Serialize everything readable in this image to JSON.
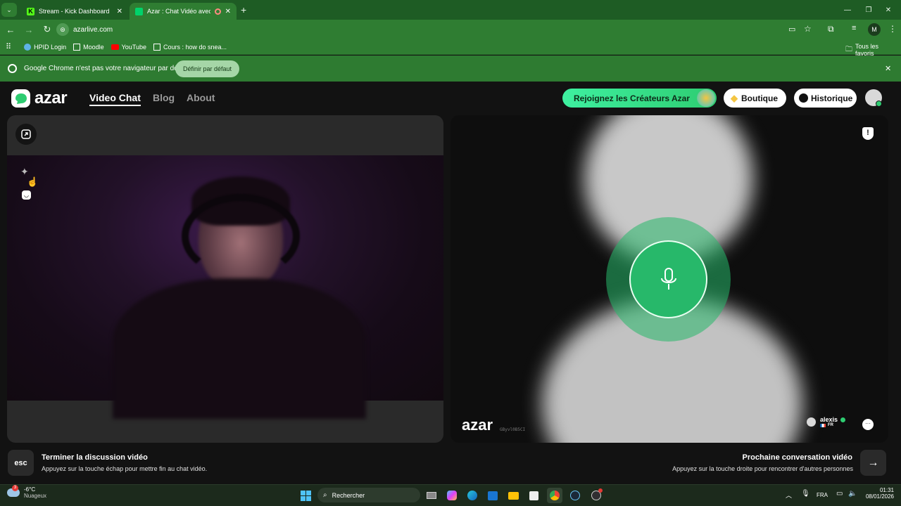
{
  "browser": {
    "tabs": [
      {
        "label": "Stream - Kick Dashboard",
        "color": "#53fc18"
      },
      {
        "label": "Azar : Chat Vidéo avec de n",
        "color": "#00d26a"
      }
    ],
    "url": "azarlive.com",
    "bookmarks": [
      "HPID Login",
      "Moodle",
      "YouTube",
      "Cours : how do snea..."
    ],
    "all_bookmarks": "Tous les favoris",
    "profile_initial": "M",
    "infobar": {
      "message": "Google Chrome n'est pas votre navigateur par défaut",
      "button": "Définir par défaut"
    }
  },
  "site": {
    "logo_text": "azar",
    "nav": [
      "Video Chat",
      "Blog",
      "About"
    ],
    "creators_button": "Rejoignez les Créateurs Azar",
    "shop_button": "Boutique",
    "history_button": "Historique"
  },
  "remote": {
    "watermark": "azar",
    "user_code": "GByvl0B5CI",
    "user_name": "alexis",
    "country": "FR"
  },
  "footer": {
    "esc_key": "esc",
    "end_title": "Terminer la discussion vidéo",
    "end_desc": "Appuyez sur la touche échap pour mettre fin au chat vidéo.",
    "next_title": "Prochaine conversation vidéo",
    "next_desc": "Appuyez sur la touche droite pour rencontrer d'autres personnes"
  },
  "taskbar": {
    "weather_temp": "-6°C",
    "weather_desc": "Nuageux",
    "weather_badge": "3",
    "search_placeholder": "Rechercher",
    "language": "FRA",
    "time": "01:31",
    "date": "08/01/2026"
  },
  "colors": {
    "accent": "#2ecc71",
    "mic_green": "#27b86a",
    "chrome_green": "#2f7d32"
  }
}
